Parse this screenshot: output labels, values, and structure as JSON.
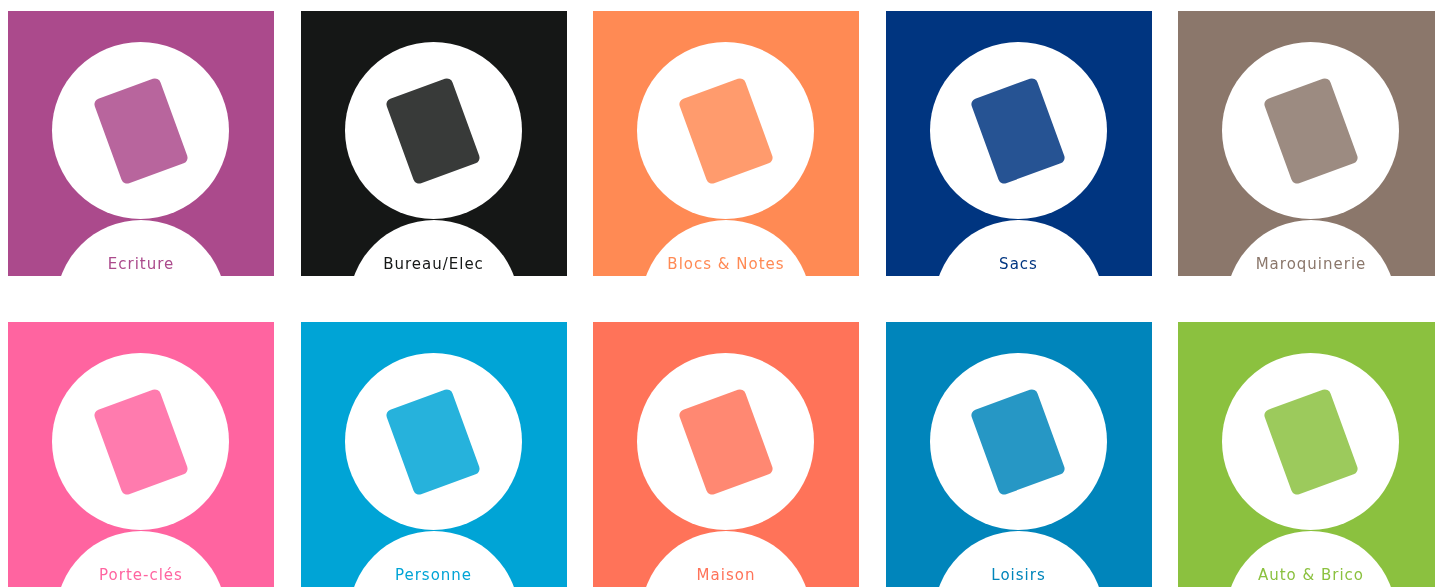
{
  "categories": [
    {
      "label": "Ecriture",
      "color": "#ab4a8c"
    },
    {
      "label": "Bureau/Elec",
      "color": "#151716"
    },
    {
      "label": "Blocs & Notes",
      "color": "#ff8a54"
    },
    {
      "label": "Sacs",
      "color": "#003580"
    },
    {
      "label": "Maroquinerie",
      "color": "#8b776b"
    },
    {
      "label": "Porte-clés",
      "color": "#ff64a0"
    },
    {
      "label": "Personne",
      "color": "#00a4d6"
    },
    {
      "label": "Maison",
      "color": "#ff7359"
    },
    {
      "label": "Loisirs",
      "color": "#0085bb"
    },
    {
      "label": "Auto & Brico",
      "color": "#8bc13f"
    }
  ]
}
